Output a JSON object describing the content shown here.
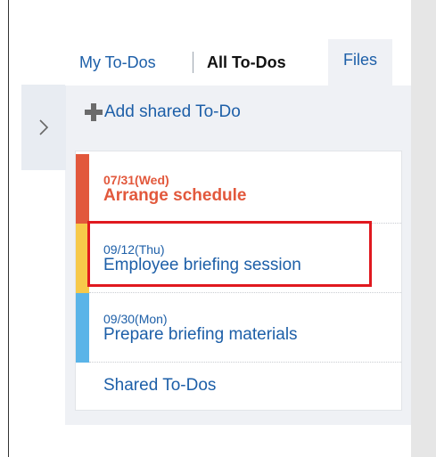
{
  "tabs": {
    "my_todos": "My To-Dos",
    "all_todos": "All To-Dos",
    "files": "Files"
  },
  "add_shared_label": "Add shared To-Do",
  "todos": [
    {
      "date": "07/31(Wed)",
      "title": "Arrange schedule",
      "color": "#e2583c",
      "overdue": true
    },
    {
      "date": "09/12(Thu)",
      "title": "Employee briefing session",
      "color": "#f7c94a",
      "highlighted": true
    },
    {
      "date": "09/30(Mon)",
      "title": "Prepare briefing materials",
      "color": "#5ab4e8"
    }
  ],
  "shared_todos_link": "Shared To-Dos",
  "colors": {
    "link": "#1d5fa8",
    "highlight_border": "#e0191f",
    "panel_bg": "#eff1f5"
  },
  "icons": {
    "collapse": "chevron-right-icon",
    "add": "plus-icon"
  }
}
